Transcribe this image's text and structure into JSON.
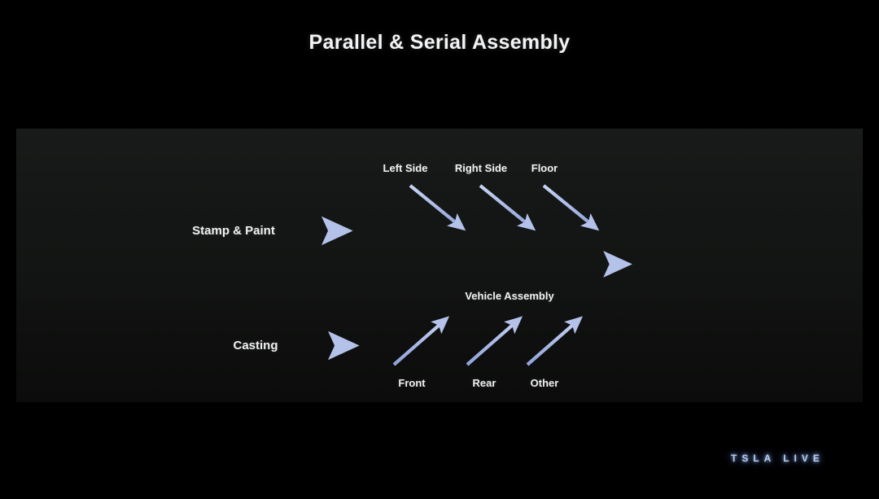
{
  "slide": {
    "title": "Parallel & Serial Assembly",
    "background_color": "#000000",
    "panel_color": "#151716",
    "accent_color": "#aebde8",
    "text_color": "#f0f1f3"
  },
  "inputs": [
    {
      "id": "stamp-paint",
      "label": "Stamp & Paint"
    },
    {
      "id": "casting",
      "label": "Casting"
    }
  ],
  "top_parts": [
    {
      "id": "left-side",
      "label": "Left Side"
    },
    {
      "id": "right-side",
      "label": "Right Side"
    },
    {
      "id": "floor",
      "label": "Floor"
    }
  ],
  "bottom_parts": [
    {
      "id": "front",
      "label": "Front"
    },
    {
      "id": "rear",
      "label": "Rear"
    },
    {
      "id": "other",
      "label": "Other"
    }
  ],
  "main_flow": {
    "label": "Vehicle Assembly"
  },
  "watermark": {
    "text": "TSLA LIVE",
    "color": "#b9cdf2"
  }
}
